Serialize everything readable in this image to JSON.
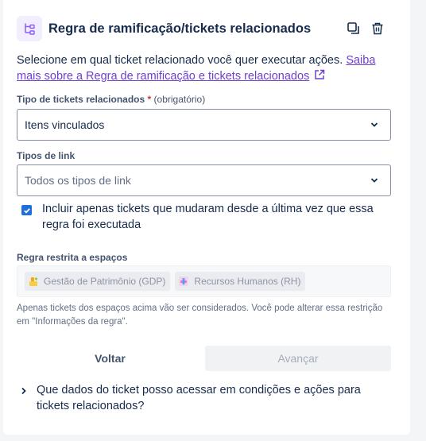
{
  "header": {
    "icon": "branch-rule-icon",
    "title": "Regra de ramificação/tickets relacionados",
    "duplicate_icon": "duplicate-icon",
    "delete_icon": "trash-icon"
  },
  "description": {
    "text": "Selecione em qual ticket relacionado você quer executar ações. ",
    "link_text": "Saiba mais sobre a Regra de ramificação e tickets relacionados",
    "link_icon": "external-link-icon"
  },
  "related_type": {
    "label": "Tipo de tickets relacionados",
    "required_mark": "*",
    "optional_text": "(obrigatório)",
    "value": "Itens vinculados"
  },
  "link_types": {
    "label": "Tipos de link",
    "placeholder": "Todos os tipos de link"
  },
  "checkbox": {
    "checked": true,
    "label": "Incluir apenas tickets que mudaram desde a última vez que essa regra foi executada"
  },
  "spaces": {
    "label": "Regra restrita a espaços",
    "chips": [
      {
        "label": "Gestão de Patrimônio (GDP)",
        "icon": "space-gdp-icon"
      },
      {
        "label": "Recursos Humanos (RH)",
        "icon": "space-rh-icon"
      }
    ],
    "help": "Apenas tickets dos espaços acima vão ser considerados. Você pode alterar essa restrição em \"Informações da regra\"."
  },
  "actions": {
    "back": "Voltar",
    "next": "Avançar"
  },
  "faq": {
    "text": "Que dados do ticket posso acessar em condições e ações para tickets relacionados?"
  },
  "colors": {
    "accent": "#6e3fd1",
    "checkbox": "#1d6fdc",
    "required": "#c9372c",
    "icon_bg": "#f3eefe"
  }
}
